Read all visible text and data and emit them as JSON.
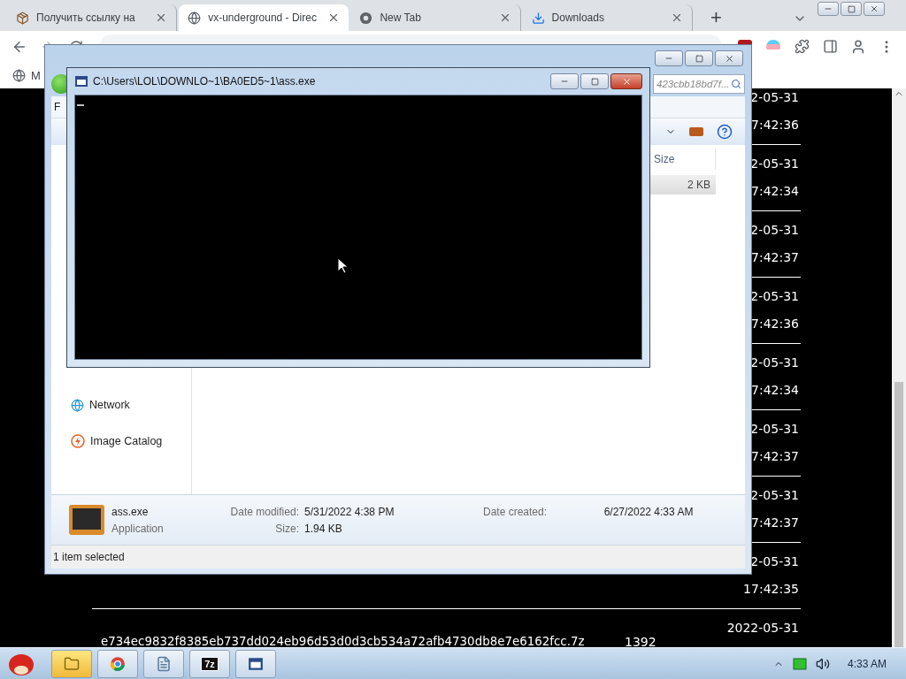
{
  "browser": {
    "tabs": [
      {
        "title": "Получить ссылку на",
        "selected": false,
        "kind": "package"
      },
      {
        "title": "vx-underground - Direc",
        "selected": true,
        "kind": "globe"
      },
      {
        "title": "New Tab",
        "selected": false,
        "kind": "chrome"
      },
      {
        "title": "Downloads",
        "selected": false,
        "kind": "download"
      }
    ],
    "new_tab": "+",
    "forward": {
      "disabled": true
    },
    "bookmark": "M"
  },
  "page": {
    "rows": [
      {
        "date": "2-05-31",
        "time": "7:42:36"
      },
      {
        "date": "2-05-31",
        "time": "7:42:34"
      },
      {
        "date": "2-05-31",
        "time": "7:42:37"
      },
      {
        "date": "2-05-31",
        "time": "7:42:36"
      },
      {
        "date": "2-05-31",
        "time": "7:42:34"
      },
      {
        "date": "2-05-31",
        "time": "7:42:37"
      },
      {
        "date": "2-05-31",
        "time": "7:42:37"
      },
      {
        "date": "2-05-31",
        "time": "17:42:35"
      },
      {
        "hash": "e734ec9832f8385eb737dd024eb96d53d0d3cb534a72afb4730db8e7e6162fcc.7z",
        "size": "1392",
        "date": "2022-05-31"
      }
    ]
  },
  "explorer": {
    "search": "423cbb18bd7f...",
    "menu": "F",
    "size_header": "Size",
    "files": [
      {
        "size": "2 KB",
        "selected": true
      }
    ],
    "nav": [
      {
        "label": "Network",
        "selected": false,
        "kind": "network"
      },
      {
        "label": "Image Catalog",
        "selected": false,
        "kind": "catalog"
      }
    ],
    "details": {
      "name": "ass.exe",
      "type": "Application",
      "modified_label": "Date modified:",
      "modified": "5/31/2022 4:38 PM",
      "size_label": "Size:",
      "size": "1.94 KB",
      "created_label": "Date created:",
      "created": "6/27/2022 4:33 AM"
    },
    "status": "1 item selected"
  },
  "console": {
    "title": "C:\\Users\\LOL\\DOWNLO~1\\BA0ED5~1\\ass.exe"
  },
  "taskbar": {
    "apps": [
      {
        "kind": "folder"
      },
      {
        "kind": "chrome"
      },
      {
        "kind": "notepad"
      },
      {
        "kind": "archiver",
        "label": "7z"
      },
      {
        "kind": "console"
      }
    ],
    "clock": "4:33 AM"
  }
}
